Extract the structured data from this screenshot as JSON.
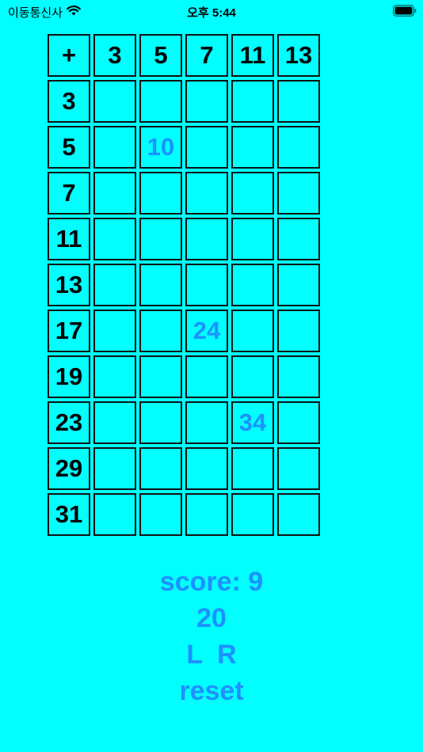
{
  "status": {
    "carrier": "이동통신사",
    "time": "오후 5:44",
    "wifi_icon": "wifi-icon",
    "battery_icon": "battery-icon"
  },
  "grid": {
    "columns": [
      "+",
      "3",
      "5",
      "7",
      "11",
      "13"
    ],
    "rows": [
      {
        "label": "3",
        "cells": [
          "",
          "",
          "",
          "",
          ""
        ]
      },
      {
        "label": "5",
        "cells": [
          "",
          "10",
          "",
          "",
          ""
        ]
      },
      {
        "label": "7",
        "cells": [
          "",
          "",
          "",
          "",
          ""
        ]
      },
      {
        "label": "11",
        "cells": [
          "",
          "",
          "",
          "",
          ""
        ]
      },
      {
        "label": "13",
        "cells": [
          "",
          "",
          "",
          "",
          ""
        ]
      },
      {
        "label": "17",
        "cells": [
          "",
          "",
          "24",
          "",
          ""
        ]
      },
      {
        "label": "19",
        "cells": [
          "",
          "",
          "",
          "",
          ""
        ]
      },
      {
        "label": "23",
        "cells": [
          "",
          "",
          "",
          "34",
          ""
        ]
      },
      {
        "label": "29",
        "cells": [
          "",
          "",
          "",
          "",
          ""
        ]
      },
      {
        "label": "31",
        "cells": [
          "",
          "",
          "",
          "",
          ""
        ]
      }
    ]
  },
  "controls": {
    "score": "score: 9",
    "target": "20",
    "left": "L",
    "right": "R",
    "reset": "reset"
  },
  "colors": {
    "background": "#00FFFF",
    "accent": "#1E90FF",
    "grid_border": "#111111"
  }
}
